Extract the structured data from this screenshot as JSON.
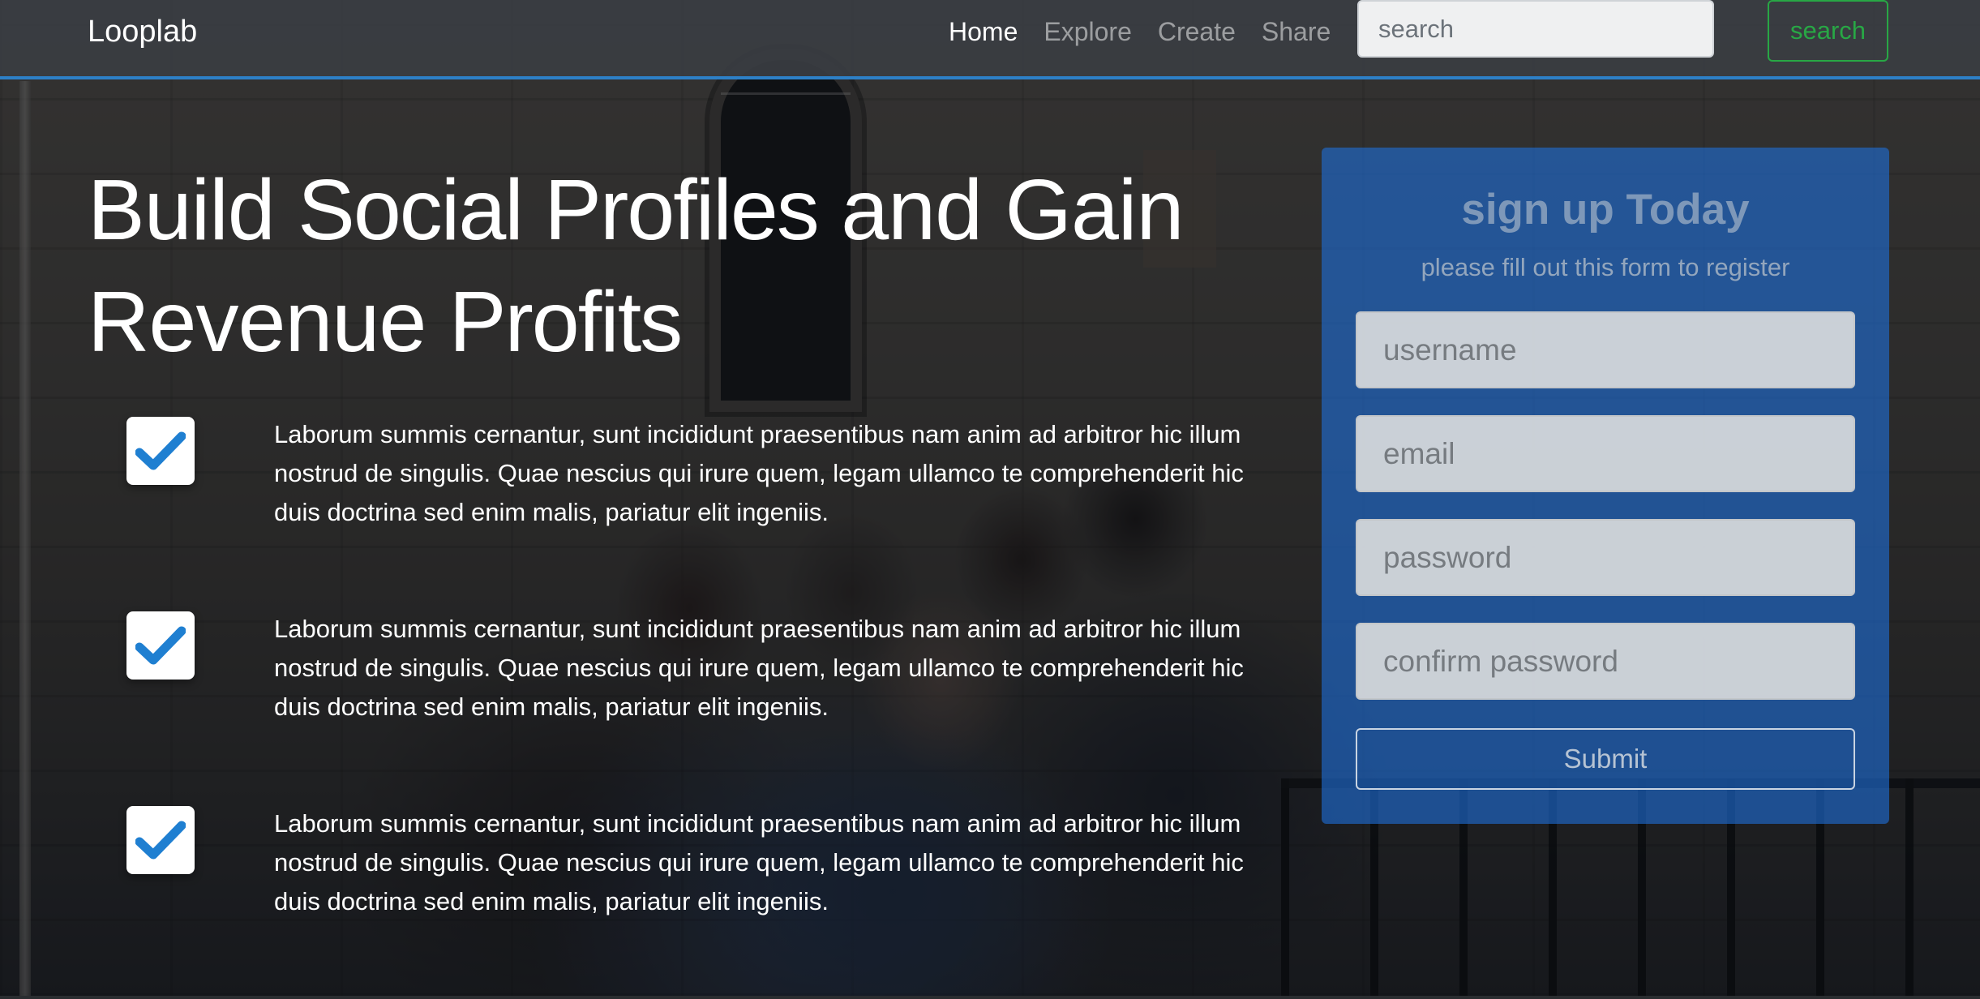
{
  "navbar": {
    "brand": "Looplab",
    "links": [
      {
        "label": "Home",
        "active": true
      },
      {
        "label": "Explore",
        "active": false
      },
      {
        "label": "Create",
        "active": false
      },
      {
        "label": "Share",
        "active": false
      }
    ],
    "search_placeholder": "search",
    "search_button": "search",
    "accent_color": "#2d80c7",
    "search_button_color": "#28a745"
  },
  "hero": {
    "title_parts": [
      "Build ",
      "Social Profiles",
      " and Gain ",
      "Revenue ",
      "Profits"
    ],
    "check_icon": "checkmark-icon",
    "features": [
      {
        "text": "Laborum summis cernantur, sunt incididunt praesentibus nam anim ad arbitror hic illum nostrud de singulis. Quae nescius qui irure quem, legam ullamco te comprehenderit hic duis doctrina sed enim malis, pariatur elit ingeniis."
      },
      {
        "text": "Laborum summis cernantur, sunt incididunt praesentibus nam anim ad arbitror hic illum nostrud de singulis. Quae nescius qui irure quem, legam ullamco te comprehenderit hic duis doctrina sed enim malis, pariatur elit ingeniis."
      },
      {
        "text": "Laborum summis cernantur, sunt incididunt praesentibus nam anim ad arbitror hic illum nostrud de singulis. Quae nescius qui irure quem, legam ullamco te comprehenderit hic duis doctrina sed enim malis, pariatur elit ingeniis."
      }
    ]
  },
  "signup": {
    "title": "sign up Today",
    "subtitle": "please fill out this form to register",
    "fields": {
      "username": {
        "placeholder": "username",
        "value": ""
      },
      "email": {
        "placeholder": "email",
        "value": ""
      },
      "password": {
        "placeholder": "password",
        "value": ""
      },
      "confirm_password": {
        "placeholder": "confirm password",
        "value": ""
      }
    },
    "submit_label": "Submit",
    "panel_color": "#1e6ed7"
  }
}
